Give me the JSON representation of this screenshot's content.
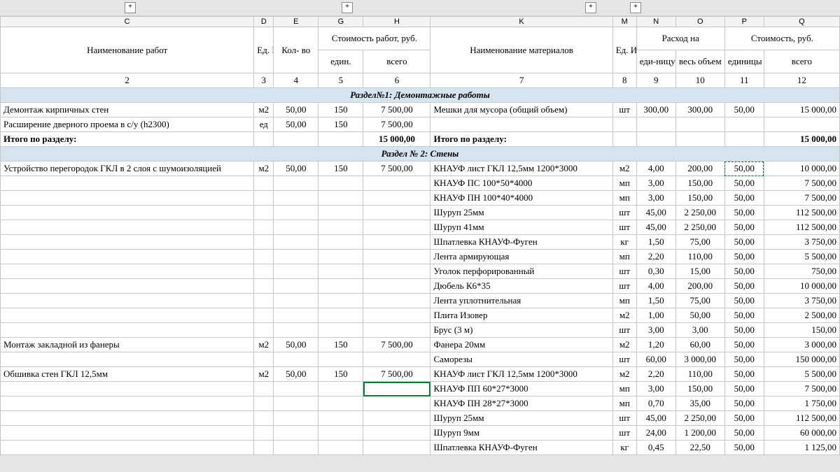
{
  "columns": [
    "C",
    "D",
    "E",
    "G",
    "H",
    "K",
    "M",
    "N",
    "O",
    "P",
    "Q"
  ],
  "outline_positions": [
    178,
    488,
    836,
    900
  ],
  "header": {
    "work_name": "Наименование работ",
    "unit": "Ед. Изм.",
    "qty": "Кол- во",
    "work_cost": "Стоимость работ, руб.",
    "per_unit": "един.",
    "total": "всего",
    "mat_name": "Наименование материалов",
    "consumption": "Расход на",
    "per_unit2": "еди-ницу",
    "full_vol": "весь объем",
    "cost": "Стоимость, руб.",
    "cost_unit": "единицы"
  },
  "numrow": [
    "2",
    "3",
    "4",
    "5",
    "6",
    "7",
    "8",
    "9",
    "10",
    "11",
    "12"
  ],
  "sections": {
    "s1": "Раздел№1: Демонтажные работы",
    "s2": "Раздел № 2: Стены"
  },
  "subtotal": "Итого по разделу:",
  "rows": [
    {
      "s": "s1"
    },
    {
      "c": "Демонтаж кирпичных стен",
      "d": "м2",
      "e": "50,00",
      "g": "150",
      "h": "7 500,00",
      "k": "Мешки для мусора (общий объем)",
      "m": "шт",
      "n": "300,00",
      "o": "300,00",
      "p": "50,00",
      "q": "15 000,00"
    },
    {
      "c": "Расширение дверного проема в с/у (h2300)",
      "d": "ед",
      "e": "50,00",
      "g": "150",
      "h": "7 500,00"
    },
    {
      "sub": true,
      "h": "15 000,00",
      "q": "15 000,00"
    },
    {
      "s": "s2"
    },
    {
      "c": "Устройство перегородок ГКЛ в 2 слоя с шумоизоляцией",
      "d": "м2",
      "e": "50,00",
      "g": "150",
      "h": "7 500,00",
      "k": "КНАУФ лист ГКЛ 12,5мм 1200*3000",
      "m": "м2",
      "n": "4,00",
      "o": "200,00",
      "p": "50,00",
      "q": "10 000,00",
      "pcopy": true
    },
    {
      "k": "КНАУФ ПС 100*50*4000",
      "m": "мп",
      "n": "3,00",
      "o": "150,00",
      "p": "50,00",
      "q": "7 500,00"
    },
    {
      "k": "КНАУФ ПН 100*40*4000",
      "m": "мп",
      "n": "3,00",
      "o": "150,00",
      "p": "50,00",
      "q": "7 500,00"
    },
    {
      "k": "Шуруп 25мм",
      "m": "шт",
      "n": "45,00",
      "o": "2 250,00",
      "p": "50,00",
      "q": "112 500,00"
    },
    {
      "k": "Шуруп 41мм",
      "m": "шт",
      "n": "45,00",
      "o": "2 250,00",
      "p": "50,00",
      "q": "112 500,00"
    },
    {
      "k": "Шпатлевка КНАУФ-Фуген",
      "m": "кг",
      "n": "1,50",
      "o": "75,00",
      "p": "50,00",
      "q": "3 750,00"
    },
    {
      "k": "Лента армирующая",
      "m": "мп",
      "n": "2,20",
      "o": "110,00",
      "p": "50,00",
      "q": "5 500,00"
    },
    {
      "k": "Уголок перфорированный",
      "m": "шт",
      "n": "0,30",
      "o": "15,00",
      "p": "50,00",
      "q": "750,00"
    },
    {
      "k": "Дюбель К6*35",
      "m": "шт",
      "n": "4,00",
      "o": "200,00",
      "p": "50,00",
      "q": "10 000,00"
    },
    {
      "k": "Лента уплотнительная",
      "m": "мп",
      "n": "1,50",
      "o": "75,00",
      "p": "50,00",
      "q": "3 750,00"
    },
    {
      "k": "Плита Изовер",
      "m": "м2",
      "n": "1,00",
      "o": "50,00",
      "p": "50,00",
      "q": "2 500,00"
    },
    {
      "k": "Брус (3 м)",
      "m": "шт",
      "n": "3,00",
      "o": "3,00",
      "p": "50,00",
      "q": "150,00"
    },
    {
      "c": "Монтаж закладной из фанеры",
      "d": "м2",
      "e": "50,00",
      "g": "150",
      "h": "7 500,00",
      "k": "Фанера 20мм",
      "m": "м2",
      "n": "1,20",
      "o": "60,00",
      "p": "50,00",
      "q": "3 000,00"
    },
    {
      "k": "Саморезы",
      "m": "шт",
      "n": "60,00",
      "o": "3 000,00",
      "p": "50,00",
      "q": "150 000,00"
    },
    {
      "c": "Обшивка стен ГКЛ 12,5мм",
      "d": "м2",
      "e": "50,00",
      "g": "150",
      "h": "7 500,00",
      "k": "КНАУФ лист ГКЛ 12,5мм 1200*3000",
      "m": "м2",
      "n": "2,20",
      "o": "110,00",
      "p": "50,00",
      "q": "5 500,00"
    },
    {
      "k": "КНАУФ ПП 60*27*3000",
      "m": "мп",
      "n": "3,00",
      "o": "150,00",
      "p": "50,00",
      "q": "7 500,00",
      "hsel": true
    },
    {
      "k": "КНАУФ ПН 28*27*3000",
      "m": "мп",
      "n": "0,70",
      "o": "35,00",
      "p": "50,00",
      "q": "1 750,00"
    },
    {
      "k": "Шуруп 25мм",
      "m": "шт",
      "n": "45,00",
      "o": "2 250,00",
      "p": "50,00",
      "q": "112 500,00"
    },
    {
      "k": "Шуруп 9мм",
      "m": "шт",
      "n": "24,00",
      "o": "1 200,00",
      "p": "50,00",
      "q": "60 000,00"
    },
    {
      "k": "Шпатлевка КНАУФ-Фуген",
      "m": "кг",
      "n": "0,45",
      "o": "22,50",
      "p": "50,00",
      "q": "1 125,00"
    }
  ]
}
